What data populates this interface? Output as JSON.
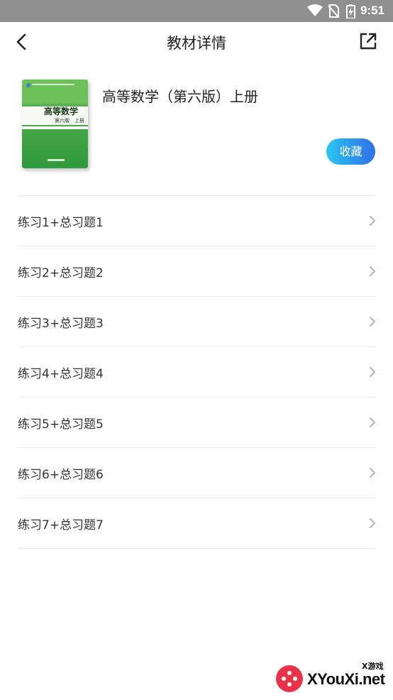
{
  "status_bar": {
    "time": "9:51"
  },
  "nav": {
    "title": "教材详情"
  },
  "book": {
    "title": "高等数学（第六版）上册",
    "cover_title": "高等数学",
    "cover_subtitle": "第六版　上册",
    "favorite_label": "收藏"
  },
  "chapters": [
    {
      "label": "练习1+总习题1"
    },
    {
      "label": "练习2+总习题2"
    },
    {
      "label": "练习3+总习题3"
    },
    {
      "label": "练习4+总习题4"
    },
    {
      "label": "练习5+总习题5"
    },
    {
      "label": "练习6+总习题6"
    },
    {
      "label": "练习7+总习题7"
    }
  ],
  "watermark": {
    "brand": "XYouXi.net",
    "tag": "X游戏"
  },
  "colors": {
    "accent_start": "#29c7f1",
    "accent_end": "#2f6fe6",
    "status_bar": "#8f8f8f",
    "divider": "#ebebeb"
  },
  "icons": {
    "back": "chevron-left-icon",
    "share": "external-link-icon",
    "row": "chevron-right-icon"
  }
}
